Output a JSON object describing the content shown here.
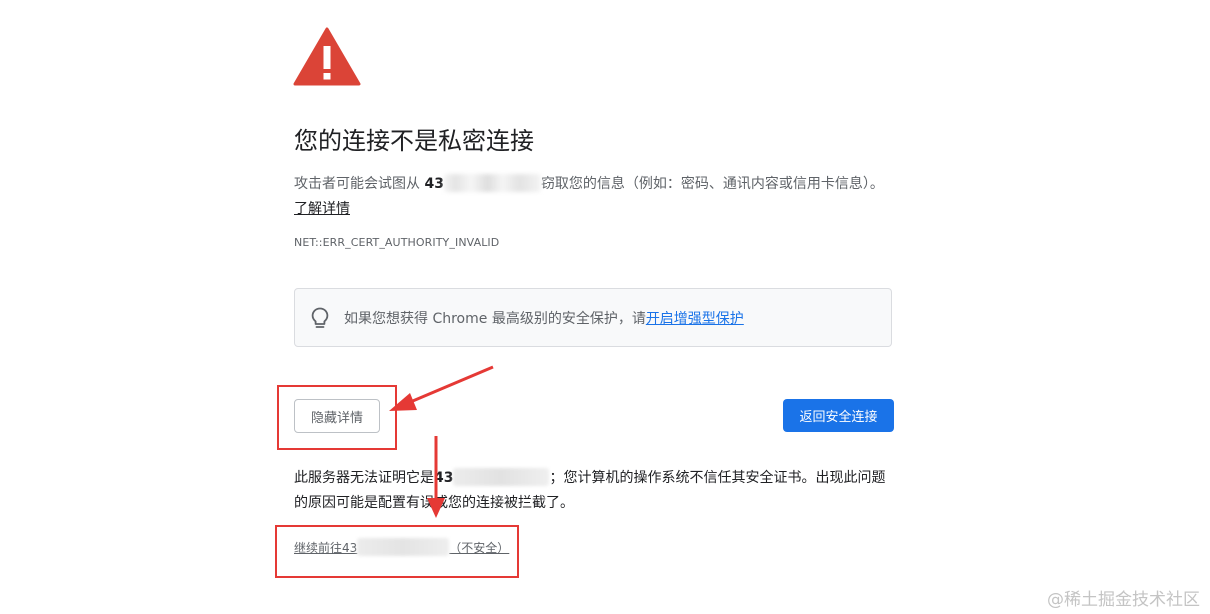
{
  "interstitial": {
    "title": "您的连接不是私密连接",
    "intro_before": "攻击者可能会试图从 ",
    "intro_host": "43",
    "intro_after": "窃取您的信息（例如：密码、通讯内容或信用卡信息）。",
    "learn_more": "了解详情",
    "error_code": "NET::ERR_CERT_AUTHORITY_INVALID"
  },
  "callout": {
    "text": "如果您想获得 Chrome 最高级别的安全保护，请",
    "link": "开启增强型保护",
    "icon": "lightbulb-icon"
  },
  "buttons": {
    "hide_details": "隐藏详情",
    "back_to_safety": "返回安全连接"
  },
  "details": {
    "text_before": "此服务器无法证明它是",
    "host": "43",
    "text_after": "；您计算机的操作系统不信任其安全证书。出现此问题的原因可能是配置有误或您的连接被拦截了。"
  },
  "proceed": {
    "before": "继续前往43",
    "after": "（不安全）"
  },
  "watermark": "@稀土掘金技术社区",
  "colors": {
    "warning_red": "#db4437",
    "primary_blue": "#1a73e8",
    "annotation_red": "#e53935"
  }
}
